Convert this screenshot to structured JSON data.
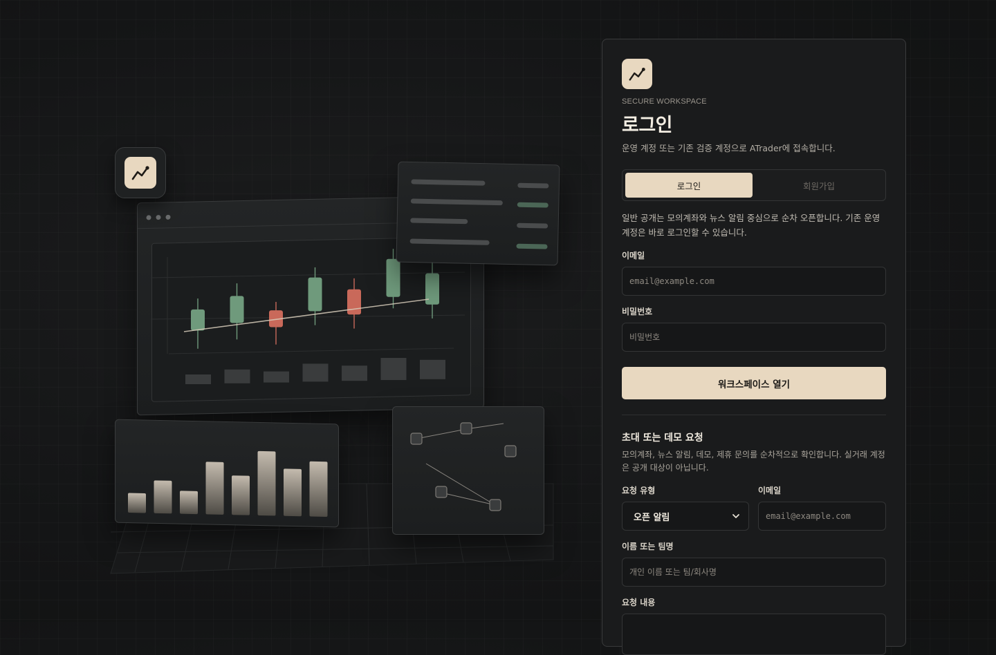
{
  "brand": {
    "logo_icon": "trend-line-icon",
    "accent": "#e8d8c0"
  },
  "card": {
    "eyebrow": "SECURE WORKSPACE",
    "title": "로그인",
    "subtitle": "운영 계정 또는 기존 검증 계정으로 ATrader에 접속합니다."
  },
  "tabs": [
    {
      "label": "로그인",
      "active": true
    },
    {
      "label": "회원가입",
      "active": false
    }
  ],
  "login": {
    "notice": "일반 공개는 모의계좌와 뉴스 알림 중심으로 순차 오픈합니다. 기존 운영 계정은 바로 로그인할 수 있습니다.",
    "email_label": "이메일",
    "email_placeholder": "email@example.com",
    "password_label": "비밀번호",
    "password_placeholder": "비밀번호",
    "submit_label": "워크스페이스 열기"
  },
  "request": {
    "title": "초대 또는 데모 요청",
    "description": "모의계좌, 뉴스 알림, 데모, 제휴 문의를 순차적으로 확인합니다. 실거래 계정은 공개 대상이 아닙니다.",
    "type_label": "요청 유형",
    "type_selected": "오픈 알림",
    "email_label": "이메일",
    "email_placeholder": "email@example.com",
    "name_label": "이름 또는 팀명",
    "name_placeholder": "개인 이름 또는 팀/회사명",
    "content_label": "요청 내용"
  },
  "illustration": {
    "candle_colors": {
      "up": "#6f9a7c",
      "down": "#c9695a"
    },
    "candles": [
      {
        "dir": "up",
        "open": 3.0,
        "close": 5.5,
        "low": 1.5,
        "high": 6.8
      },
      {
        "dir": "up",
        "open": 3.8,
        "close": 7.0,
        "low": 2.5,
        "high": 8.5
      },
      {
        "dir": "down",
        "open": 5.2,
        "close": 3.2,
        "low": 1.8,
        "high": 6.2
      },
      {
        "dir": "up",
        "open": 5.0,
        "close": 9.0,
        "low": 4.0,
        "high": 10.2
      },
      {
        "dir": "down",
        "open": 7.5,
        "close": 4.5,
        "low": 3.5,
        "high": 8.8
      },
      {
        "dir": "up",
        "open": 6.5,
        "close": 11.0,
        "low": 5.8,
        "high": 12.2
      },
      {
        "dir": "up",
        "open": 5.5,
        "close": 9.2,
        "low": 4.5,
        "high": 10.5
      }
    ],
    "bars": [
      3,
      5,
      3.5,
      8,
      6,
      9.8,
      7.2,
      8.4
    ]
  }
}
